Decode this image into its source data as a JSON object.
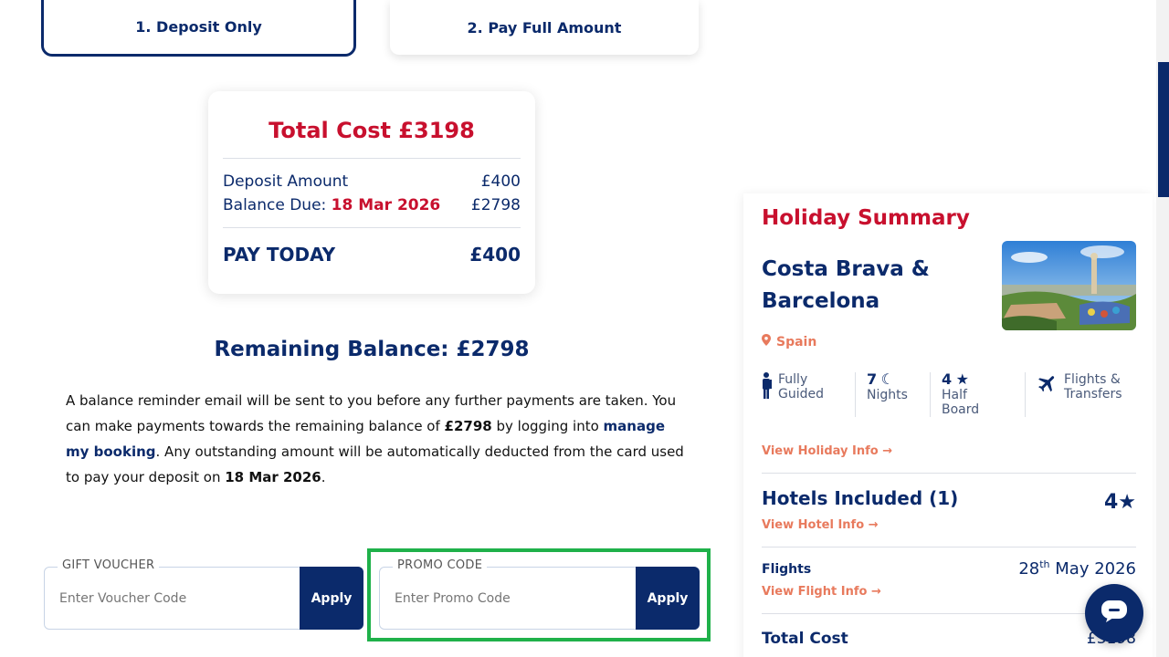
{
  "payment_options": {
    "deposit_label": "1. Deposit Only",
    "full_label": "2. Pay Full Amount"
  },
  "cost_card": {
    "title": "Total Cost £3198",
    "deposit_label": "Deposit Amount",
    "deposit_value": "£400",
    "balance_label": "Balance Due: ",
    "balance_date": "18 Mar 2026",
    "balance_value": "£2798",
    "pay_today_label": "PAY TODAY",
    "pay_today_value": "£400"
  },
  "remaining_balance": "Remaining Balance: £2798",
  "info": {
    "part1": "A balance reminder email will be sent to you before any further payments are taken. You can make payments towards the remaining balance of ",
    "amount": "£2798",
    "part2": " by logging into ",
    "link": "manage my booking",
    "part3": ". Any outstanding amount will be automatically deducted from the card used to pay your deposit on ",
    "date": "18 Mar 2026",
    "part4": "."
  },
  "gift_voucher": {
    "label": "GIFT VOUCHER",
    "placeholder": "Enter Voucher Code",
    "button": "Apply"
  },
  "promo_code": {
    "label": "PROMO CODE",
    "placeholder": "Enter Promo Code",
    "button": "Apply"
  },
  "summary": {
    "title": "Holiday Summary",
    "trip_name": "Costa Brava & Barcelona",
    "location": "Spain",
    "features": [
      {
        "icon": "guide-person-icon",
        "line1": "Fully",
        "line2": "Guided"
      },
      {
        "icon": "moon-icon",
        "num": "7",
        "line2": "Nights"
      },
      {
        "icon": "star-icon",
        "num": "4",
        "line2": "Half",
        "line3": "Board"
      },
      {
        "icon": "plane-icon",
        "line1": "Flights &",
        "line2": "Transfers"
      }
    ],
    "view_holiday": "View Holiday Info",
    "hotels_title": "Hotels Included (1)",
    "hotel_rating": "4★",
    "view_hotel": "View Hotel Info",
    "flights_title": "Flights",
    "flight_day": "28",
    "flight_sup": "th",
    "flight_rest": " May 2026",
    "view_flight": "View Flight Info",
    "total_label": "Total Cost",
    "total_value": "£3198"
  },
  "colors": {
    "navy": "#0b2a6b",
    "red": "#c8102e",
    "coral": "#e87a5d",
    "highlight": "#1fb14a"
  }
}
